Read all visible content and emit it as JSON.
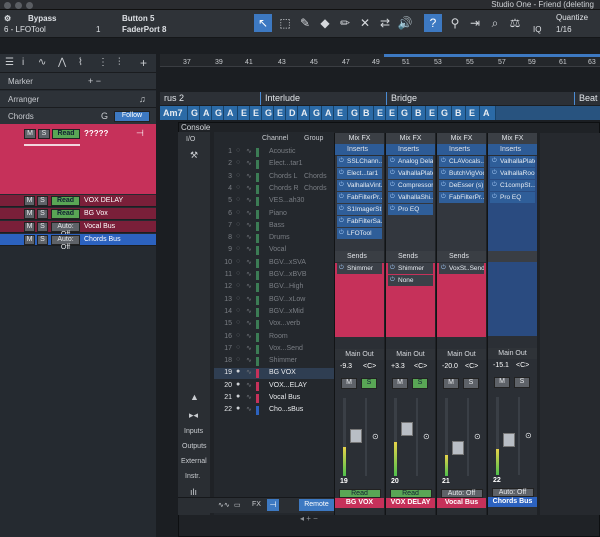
{
  "window": {
    "title": "Studio One - Friend (deleting"
  },
  "toolbar": {
    "insert_label": "Bypass",
    "insert_sub": "6 - LFOTool",
    "button_label": "Button 5",
    "button_sub": "FaderPort 8",
    "page_num": "1",
    "quantize_label": "Quantize",
    "quantize_value": "1/16",
    "iq": "IQ"
  },
  "ruler": {
    "bars": [
      "37",
      "39",
      "41",
      "43",
      "45",
      "47",
      "49",
      "51",
      "53",
      "55",
      "57",
      "59",
      "61",
      "63"
    ]
  },
  "arranger": {
    "sections": [
      {
        "label": "rus 2"
      },
      {
        "label": "Interlude"
      },
      {
        "label": "Bridge"
      },
      {
        "label": "Beat"
      }
    ]
  },
  "chords": [
    "Am7",
    "G",
    "A",
    "G",
    "A",
    "E",
    "E",
    "G",
    "E",
    "D",
    "A",
    "G",
    "A",
    "E",
    "G",
    "B",
    "E",
    "E",
    "G",
    "B",
    "E",
    "G",
    "B",
    "E",
    "A"
  ],
  "sidebar": {
    "rows": [
      {
        "label": "Marker",
        "icon": "+ −"
      },
      {
        "label": "Arranger",
        "icon": "♫"
      },
      {
        "label": "Chords",
        "extra": "G",
        "button": "Follow"
      }
    ],
    "main_track": {
      "name": "?????",
      "read": "Read",
      "m": "M",
      "s": "S"
    },
    "tracks": [
      {
        "name": "VOX DELAY",
        "mode": "Read"
      },
      {
        "name": "BG Vox",
        "mode": "Read"
      },
      {
        "name": "Vocal Bus",
        "mode": "Auto: Off"
      },
      {
        "name": "Chords Bus",
        "mode": "Auto: Off"
      }
    ]
  },
  "console": {
    "title": "Console",
    "io": "I/O",
    "headers": {
      "channel": "Channel",
      "group": "Group"
    },
    "left_buttons": [
      "Inputs",
      "Outputs",
      "External",
      "Instr."
    ],
    "channels": [
      {
        "n": "1",
        "name": "Acoustic",
        "group": "",
        "color": "#3c7c55",
        "active": false
      },
      {
        "n": "2",
        "name": "Elect...tar1",
        "group": "",
        "color": "#3c7c55",
        "active": false
      },
      {
        "n": "3",
        "name": "Chords L",
        "group": "Chords",
        "color": "#3c7c55",
        "active": false
      },
      {
        "n": "4",
        "name": "Chords R",
        "group": "Chords",
        "color": "#3c7c55",
        "active": false
      },
      {
        "n": "5",
        "name": "VES...ah30",
        "group": "",
        "color": "#3c7c55",
        "active": false
      },
      {
        "n": "6",
        "name": "Piano",
        "group": "",
        "color": "#3c7c55",
        "active": false
      },
      {
        "n": "7",
        "name": "Bass",
        "group": "",
        "color": "#3c7c55",
        "active": false
      },
      {
        "n": "8",
        "name": "Drums",
        "group": "",
        "color": "#3c7c55",
        "active": false
      },
      {
        "n": "9",
        "name": "Vocal",
        "group": "",
        "color": "#3c7c55",
        "active": false
      },
      {
        "n": "10",
        "name": "BGV...xSVA",
        "group": "",
        "color": "#3c7c55",
        "active": false
      },
      {
        "n": "11",
        "name": "BGV...xBVB",
        "group": "",
        "color": "#3c7c55",
        "active": false
      },
      {
        "n": "12",
        "name": "BGV...High",
        "group": "",
        "color": "#3c7c55",
        "active": false
      },
      {
        "n": "13",
        "name": "BGV...xLow",
        "group": "",
        "color": "#3c7c55",
        "active": false
      },
      {
        "n": "14",
        "name": "BGV...xMid",
        "group": "",
        "color": "#3c7c55",
        "active": false
      },
      {
        "n": "15",
        "name": "Vox...verb",
        "group": "",
        "color": "#3c7c55",
        "active": false
      },
      {
        "n": "16",
        "name": "Room",
        "group": "",
        "color": "#3c7c55",
        "active": false
      },
      {
        "n": "17",
        "name": "Vox...Send",
        "group": "",
        "color": "#3c7c55",
        "active": false
      },
      {
        "n": "18",
        "name": "Shimmer",
        "group": "",
        "color": "#3c7c55",
        "active": false
      },
      {
        "n": "19",
        "name": "BG VOX",
        "group": "",
        "color": "#c6315a",
        "active": true
      },
      {
        "n": "20",
        "name": "VOX...ELAY",
        "group": "",
        "color": "#c6315a",
        "active": true
      },
      {
        "n": "21",
        "name": "Vocal Bus",
        "group": "",
        "color": "#c6315a",
        "active": true
      },
      {
        "n": "22",
        "name": "Cho...sBus",
        "group": "",
        "color": "#2c62bf",
        "active": true
      }
    ],
    "bottom": {
      "fx": "FX",
      "remote": "Remote"
    },
    "strips": [
      {
        "mixfx": "Mix FX",
        "inserts_label": "Inserts",
        "inserts": [
          "SSLChann...",
          "Elect...tar1",
          "ValhallaVint...",
          "FabFilterPr...",
          "S1ImagerSt...",
          "FabFilterSa...",
          "LFOTool"
        ],
        "sends_label": "Sends",
        "sends": [
          "Shimmer"
        ],
        "output": "Main Out",
        "vol": "-9.3",
        "pan": "<C>",
        "num": "19",
        "mode": "Read",
        "name": "BG VOX",
        "color": "#c6315a",
        "level": 0.62
      },
      {
        "mixfx": "Mix FX",
        "inserts_label": "Inserts",
        "inserts": [
          "Analog Delay",
          "ValhallaPlate",
          "Compressor",
          "ValhallaShi...",
          "Pro EQ"
        ],
        "sends_label": "Sends",
        "sends": [
          "Shimmer",
          "None"
        ],
        "output": "Main Out",
        "vol": "+3.3",
        "pan": "<C>",
        "num": "20",
        "mode": "Read",
        "name": "VOX DELAY",
        "color": "#c6315a",
        "level": 0.72
      },
      {
        "mixfx": "Mix FX",
        "inserts_label": "Inserts",
        "inserts": [
          "CLAVocals...",
          "ButchVigVoc...",
          "DeEsser (s)",
          "FabFilterPr..."
        ],
        "sends_label": "Sends",
        "sends": [
          "VoxSt..Send"
        ],
        "output": "Main Out",
        "vol": "-20.0",
        "pan": "<C>",
        "num": "21",
        "mode": "Auto: Off",
        "name": "Vocal Bus",
        "color": "#c6315a",
        "level": 0.45
      },
      {
        "mixfx": "Mix FX",
        "inserts_label": "Inserts",
        "inserts": [
          "ValhallaPlate",
          "ValhallaRoo...",
          "C1compSt...",
          "Pro EQ"
        ],
        "sends_label": "",
        "sends": [],
        "output": "Main Out",
        "vol": "-15.1",
        "pan": "<C>",
        "num": "22",
        "mode": "Auto: Off",
        "name": "Chords Bus",
        "color": "#2c62bf",
        "level": 0.55
      }
    ]
  }
}
